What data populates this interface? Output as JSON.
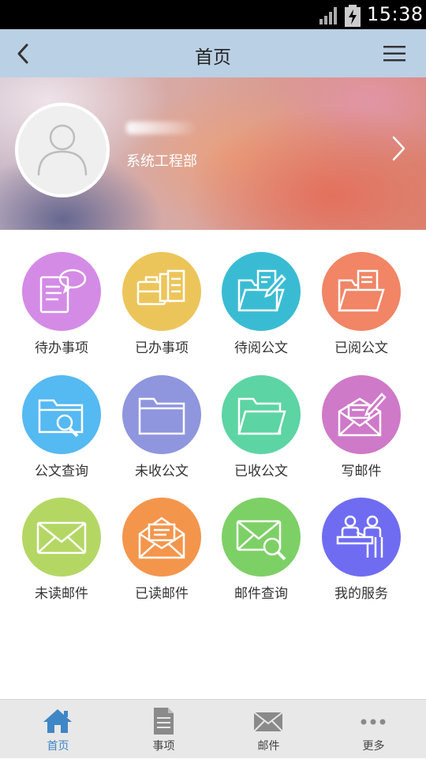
{
  "status_bar": {
    "time": "15:38",
    "signal_icon": "signal-icon",
    "battery_icon": "battery-charging-icon"
  },
  "nav": {
    "title": "首页",
    "back_icon": "chevron-left-icon",
    "menu_icon": "hamburger-menu-icon"
  },
  "profile": {
    "department": "系统工程部",
    "avatar_icon": "user-avatar-icon",
    "arrow_icon": "chevron-right-icon"
  },
  "grid": [
    {
      "label": "待办事项",
      "color": "#d48be6",
      "icon": "todo-document-icon"
    },
    {
      "label": "已办事项",
      "color": "#ecc55a",
      "icon": "briefcase-documents-icon"
    },
    {
      "label": "待阅公文",
      "color": "#39bcd3",
      "icon": "folder-edit-icon"
    },
    {
      "label": "已阅公文",
      "color": "#f18565",
      "icon": "folder-document-icon"
    },
    {
      "label": "公文查询",
      "color": "#55b9f2",
      "icon": "folder-search-icon"
    },
    {
      "label": "未收公文",
      "color": "#8f96dd",
      "icon": "folder-icon"
    },
    {
      "label": "已收公文",
      "color": "#5dd4a4",
      "icon": "folder-open-icon"
    },
    {
      "label": "写邮件",
      "color": "#cf79c9",
      "icon": "mail-write-icon"
    },
    {
      "label": "未读邮件",
      "color": "#b4d764",
      "icon": "envelope-icon"
    },
    {
      "label": "已读邮件",
      "color": "#f4954c",
      "icon": "envelope-open-icon"
    },
    {
      "label": "邮件查询",
      "color": "#7dd066",
      "icon": "mail-search-icon"
    },
    {
      "label": "我的服务",
      "color": "#6f6cf2",
      "icon": "service-desk-icon"
    }
  ],
  "tabs": [
    {
      "label": "首页",
      "icon": "home-icon",
      "active": true
    },
    {
      "label": "事项",
      "icon": "document-icon",
      "active": false
    },
    {
      "label": "邮件",
      "icon": "envelope-icon",
      "active": false
    },
    {
      "label": "更多",
      "icon": "more-dots-icon",
      "active": false
    }
  ],
  "colors": {
    "nav_bg": "#bad0e5",
    "tab_active": "#3f86c6",
    "tab_inactive": "#8a8a8a"
  }
}
